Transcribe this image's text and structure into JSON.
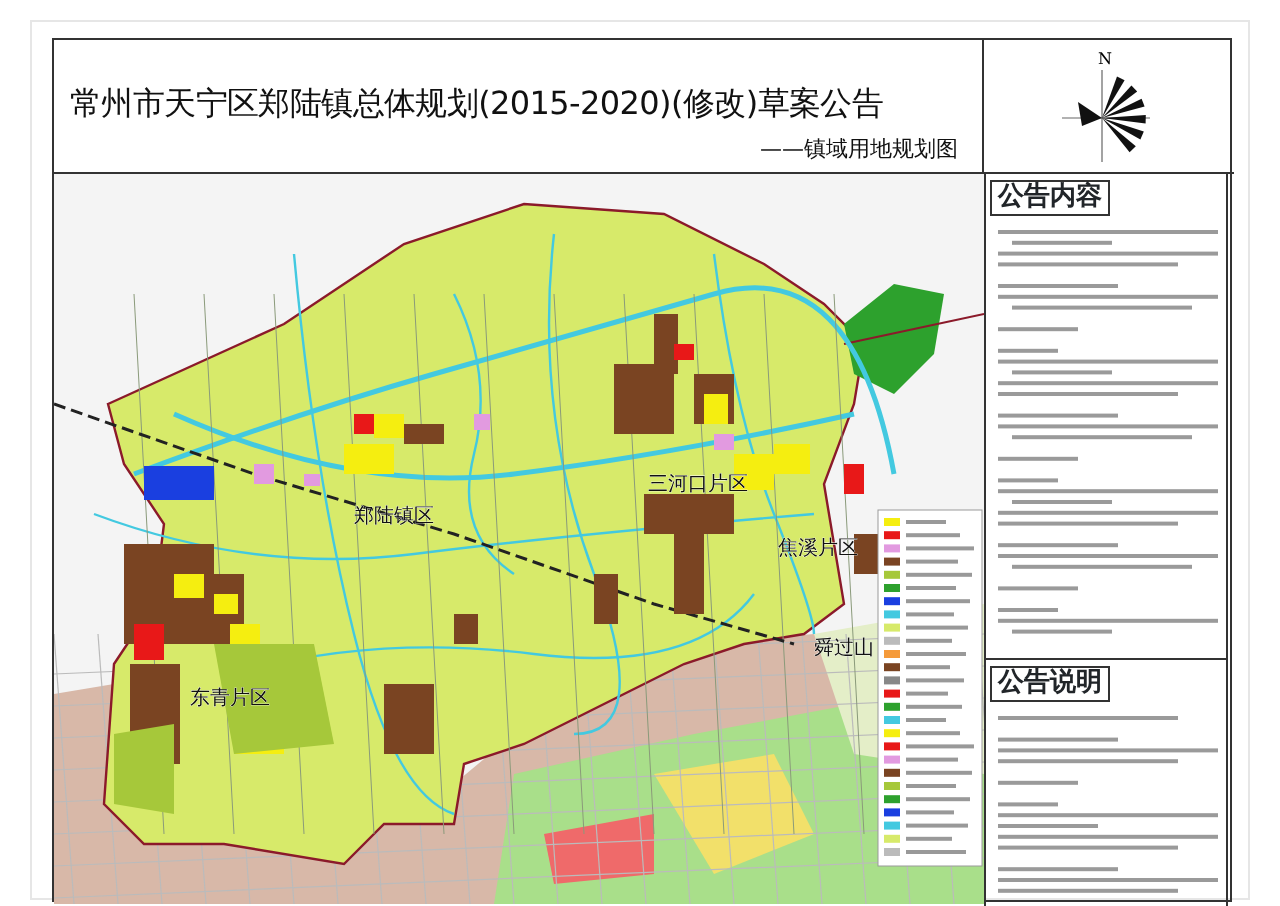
{
  "header": {
    "title": "常州市天宁区郑陆镇总体规划(2015-2020)(修改)草案公告",
    "subtitle": "——镇域用地规划图"
  },
  "compass": {
    "label": "N"
  },
  "map": {
    "labels": [
      {
        "text": "郑陆镇区"
      },
      {
        "text": "三河口片区"
      },
      {
        "text": "焦溪片区"
      },
      {
        "text": "东青片区"
      },
      {
        "text": "舜过山"
      }
    ]
  },
  "notice": {
    "heading": "公告内容"
  },
  "explanation": {
    "heading": "公告说明"
  }
}
